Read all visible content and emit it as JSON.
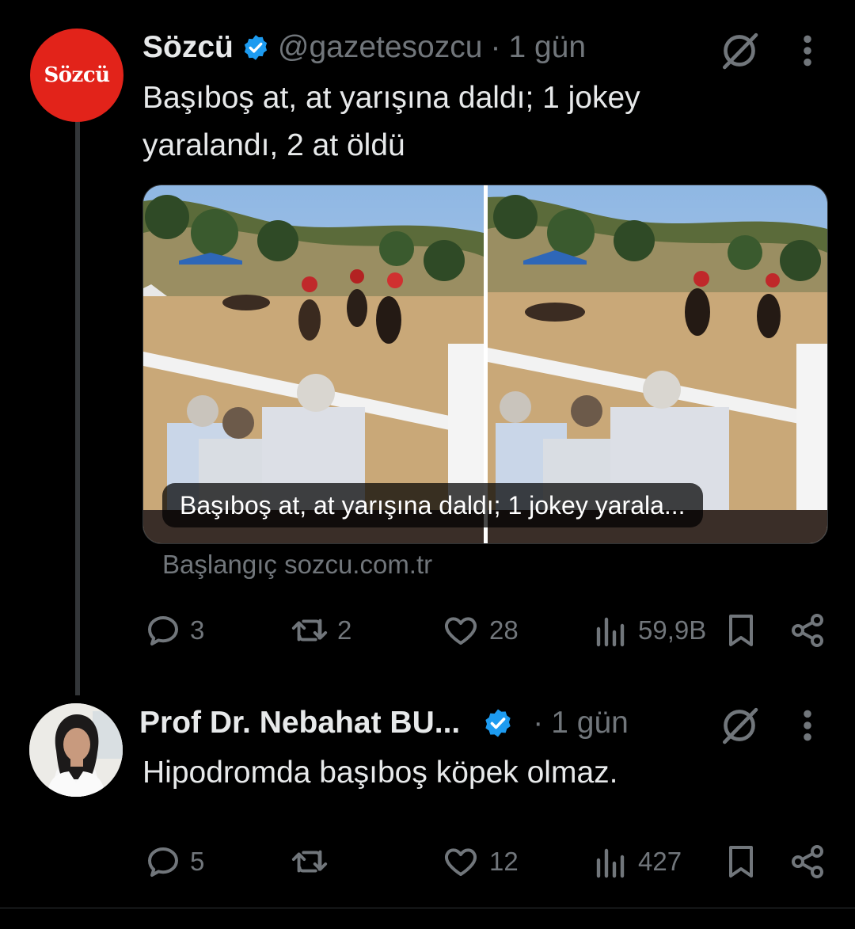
{
  "tweets": [
    {
      "author": "Sözcü",
      "handle": "@gazetesozcu",
      "time": "1 gün",
      "avatar_logo": "Sözcü",
      "text": "Başıboş at, at yarışına daldı; 1 jokey yaralandı, 2 at öldü",
      "media_caption": "Başıboş at, at yarışına daldı; 1 jokey yarala...",
      "source": "Başlangıç sozcu.com.tr",
      "actions": {
        "replies": "3",
        "retweets": "2",
        "likes": "28",
        "views": "59,9B"
      }
    },
    {
      "author": "Prof Dr. Nebahat BU...",
      "time": "1 gün",
      "text": "Hipodromda başıboş köpek olmaz.",
      "actions": {
        "replies": "5",
        "retweets": "",
        "likes": "12",
        "views": "427"
      }
    }
  ],
  "icons": {
    "verified": "verified-badge-icon",
    "grok": "grok-icon",
    "more": "more-vertical-icon",
    "reply": "reply-icon",
    "retweet": "retweet-icon",
    "like": "heart-icon",
    "views": "views-icon",
    "bookmark": "bookmark-icon",
    "share": "share-icon"
  },
  "colors": {
    "background": "#000000",
    "text": "#e7e9ea",
    "muted": "#71767b",
    "verified": "#1d9bf0",
    "brand_red": "#e2231a"
  }
}
